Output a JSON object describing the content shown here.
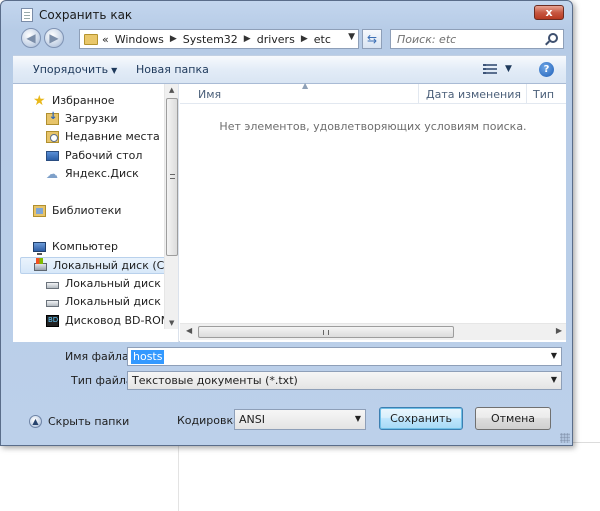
{
  "window": {
    "title": "Сохранить как",
    "close_label": "x"
  },
  "address": {
    "overflow": "«",
    "crumbs": [
      "Windows",
      "System32",
      "drivers",
      "etc"
    ],
    "search_placeholder": "Поиск: etc"
  },
  "toolbar": {
    "organize": "Упорядочить",
    "new_folder": "Новая папка",
    "help": "?"
  },
  "nav": {
    "favorites": "Избранное",
    "downloads": "Загрузки",
    "recent": "Недавние места",
    "desktop": "Рабочий стол",
    "yandex_disk": "Яндекс.Диск",
    "libraries": "Библиотеки",
    "computer": "Компьютер",
    "drive_c": "Локальный диск (C:)",
    "drive_d": "Локальный диск (D:)",
    "drive_e": "Локальный диск (E:)",
    "bd_rom": "Дисковод BD-ROM (G"
  },
  "file_list": {
    "columns": [
      "Имя",
      "Дата изменения",
      "Тип"
    ],
    "empty_message": "Нет элементов, удовлетворяющих условиям поиска."
  },
  "form": {
    "filename_label": "Имя файла:",
    "filename_value": "hosts",
    "filetype_label": "Тип файла:",
    "filetype_value": "Текстовые документы (*.txt)",
    "encoding_label": "Кодировка:",
    "encoding_value": "ANSI",
    "hide_folders": "Скрыть папки",
    "save": "Сохранить",
    "cancel": "Отмена"
  },
  "colors": {
    "selection": "#3399ff",
    "title_bar": "#c3d6ee",
    "close_button": "#c75842"
  }
}
